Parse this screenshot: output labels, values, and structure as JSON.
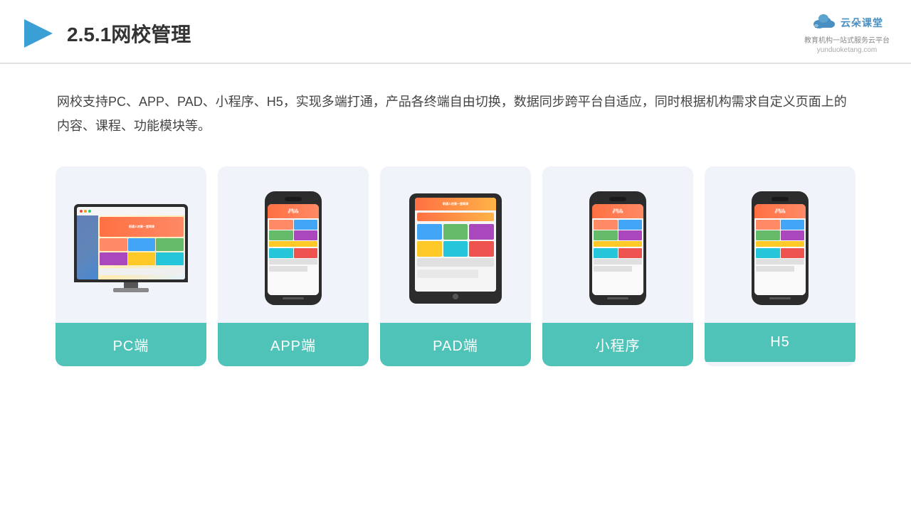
{
  "header": {
    "title": "2.5.1网校管理",
    "logo_brand": "云朵课堂",
    "logo_url": "yunduoketang.com",
    "logo_tagline": "教育机构一站\n式服务云平台"
  },
  "description": "网校支持PC、APP、PAD、小程序、H5，实现多端打通，产品各终端自由切换，数据同步跨平台自适应，同时根据机构需求自定义页面上的内容、课程、功能模块等。",
  "cards": [
    {
      "id": "pc",
      "label": "PC端"
    },
    {
      "id": "app",
      "label": "APP端"
    },
    {
      "id": "pad",
      "label": "PAD端"
    },
    {
      "id": "miniprogram",
      "label": "小程序"
    },
    {
      "id": "h5",
      "label": "H5"
    }
  ],
  "accent_color": "#4fc3b8"
}
